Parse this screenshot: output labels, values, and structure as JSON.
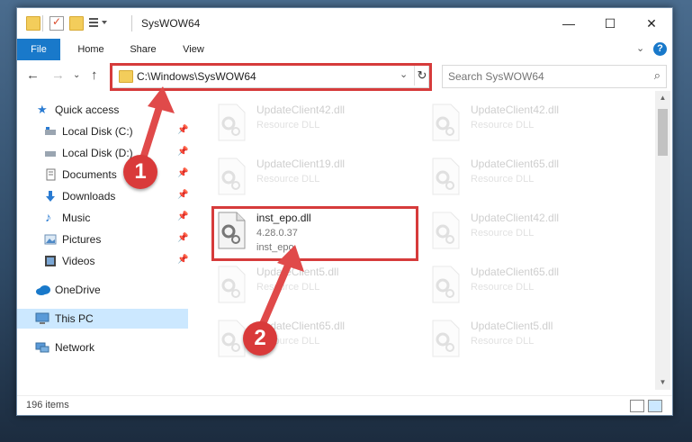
{
  "window": {
    "title": "SysWOW64",
    "controls": {
      "minimize": "—",
      "maximize": "☐",
      "close": "✕"
    }
  },
  "ribbon": {
    "tabs": [
      "File",
      "Home",
      "Share",
      "View"
    ],
    "expand_glyph": "⌄",
    "help_glyph": "?"
  },
  "address": {
    "path": "C:\\Windows\\SysWOW64",
    "dropdown_glyph": "⌄",
    "refresh_glyph": "↻",
    "back_glyph": "←",
    "forward_glyph": "→",
    "recent_glyph": "⌄",
    "up_glyph": "↑"
  },
  "search": {
    "placeholder": "Search SysWOW64",
    "icon_glyph": "⌕"
  },
  "sidebar": {
    "items": [
      {
        "label": "Quick access",
        "icon": "star-icon"
      },
      {
        "label": "Local Disk (C:)",
        "icon": "drive-icon",
        "pinned": true
      },
      {
        "label": "Local Disk (D:)",
        "icon": "drive-icon",
        "pinned": true
      },
      {
        "label": "Documents",
        "icon": "documents-icon",
        "pinned": true
      },
      {
        "label": "Downloads",
        "icon": "download-icon",
        "pinned": true
      },
      {
        "label": "Music",
        "icon": "music-icon",
        "pinned": true
      },
      {
        "label": "Pictures",
        "icon": "pictures-icon",
        "pinned": true
      },
      {
        "label": "Videos",
        "icon": "videos-icon",
        "pinned": true
      },
      {
        "label": "OneDrive",
        "icon": "cloud-icon"
      },
      {
        "label": "This PC",
        "icon": "computer-icon",
        "selected": true
      },
      {
        "label": "Network",
        "icon": "network-icon"
      }
    ],
    "pin_glyph": "📌"
  },
  "files": {
    "left": [
      {
        "name": "UpdateClient42.dll",
        "line2": "Resource DLL"
      },
      {
        "name": "UpdateClient19.dll",
        "line2": "Resource DLL"
      },
      {
        "name": "inst_epo.dll",
        "line2": "4.28.0.37",
        "line3": "inst_epo"
      },
      {
        "name": "UpdateClient5.dll",
        "line2": "Resource DLL"
      },
      {
        "name": "UpdateClient65.dll",
        "line2": "Resource DLL"
      }
    ],
    "right": [
      {
        "name": "UpdateClient42.dll",
        "line2": "Resource DLL"
      },
      {
        "name": "UpdateClient65.dll",
        "line2": "Resource DLL"
      },
      {
        "name": "UpdateClient42.dll",
        "line2": "Resource DLL"
      },
      {
        "name": "UpdateClient65.dll",
        "line2": "Resource DLL"
      },
      {
        "name": "UpdateClient5.dll",
        "line2": "Resource DLL"
      }
    ]
  },
  "status": {
    "item_count": "196 items"
  },
  "callouts": {
    "step1": "1",
    "step2": "2"
  },
  "colors": {
    "accent": "#1979ca",
    "callout": "#d63b3b",
    "selected": "#cce8ff"
  }
}
